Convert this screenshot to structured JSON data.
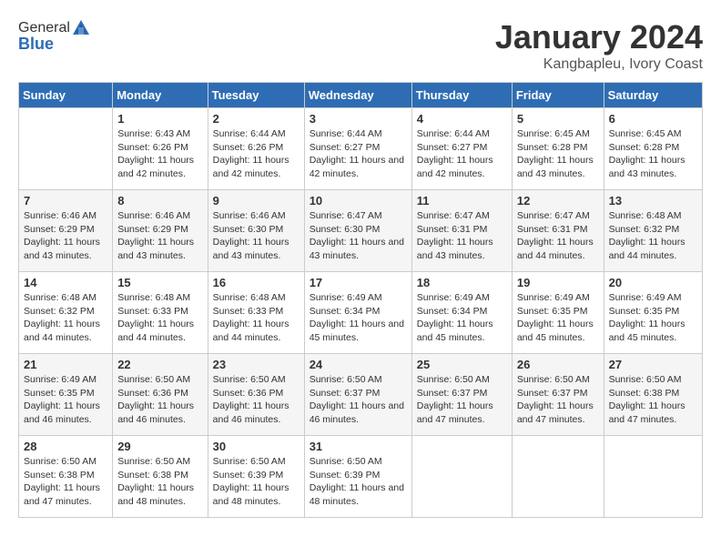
{
  "header": {
    "logo": {
      "general": "General",
      "blue": "Blue"
    },
    "title": "January 2024",
    "location": "Kangbapleu, Ivory Coast"
  },
  "weekdays": [
    "Sunday",
    "Monday",
    "Tuesday",
    "Wednesday",
    "Thursday",
    "Friday",
    "Saturday"
  ],
  "weeks": [
    [
      {
        "day": "",
        "sunrise": "",
        "sunset": "",
        "daylight": ""
      },
      {
        "day": "1",
        "sunrise": "Sunrise: 6:43 AM",
        "sunset": "Sunset: 6:26 PM",
        "daylight": "Daylight: 11 hours and 42 minutes."
      },
      {
        "day": "2",
        "sunrise": "Sunrise: 6:44 AM",
        "sunset": "Sunset: 6:26 PM",
        "daylight": "Daylight: 11 hours and 42 minutes."
      },
      {
        "day": "3",
        "sunrise": "Sunrise: 6:44 AM",
        "sunset": "Sunset: 6:27 PM",
        "daylight": "Daylight: 11 hours and 42 minutes."
      },
      {
        "day": "4",
        "sunrise": "Sunrise: 6:44 AM",
        "sunset": "Sunset: 6:27 PM",
        "daylight": "Daylight: 11 hours and 42 minutes."
      },
      {
        "day": "5",
        "sunrise": "Sunrise: 6:45 AM",
        "sunset": "Sunset: 6:28 PM",
        "daylight": "Daylight: 11 hours and 43 minutes."
      },
      {
        "day": "6",
        "sunrise": "Sunrise: 6:45 AM",
        "sunset": "Sunset: 6:28 PM",
        "daylight": "Daylight: 11 hours and 43 minutes."
      }
    ],
    [
      {
        "day": "7",
        "sunrise": "Sunrise: 6:46 AM",
        "sunset": "Sunset: 6:29 PM",
        "daylight": "Daylight: 11 hours and 43 minutes."
      },
      {
        "day": "8",
        "sunrise": "Sunrise: 6:46 AM",
        "sunset": "Sunset: 6:29 PM",
        "daylight": "Daylight: 11 hours and 43 minutes."
      },
      {
        "day": "9",
        "sunrise": "Sunrise: 6:46 AM",
        "sunset": "Sunset: 6:30 PM",
        "daylight": "Daylight: 11 hours and 43 minutes."
      },
      {
        "day": "10",
        "sunrise": "Sunrise: 6:47 AM",
        "sunset": "Sunset: 6:30 PM",
        "daylight": "Daylight: 11 hours and 43 minutes."
      },
      {
        "day": "11",
        "sunrise": "Sunrise: 6:47 AM",
        "sunset": "Sunset: 6:31 PM",
        "daylight": "Daylight: 11 hours and 43 minutes."
      },
      {
        "day": "12",
        "sunrise": "Sunrise: 6:47 AM",
        "sunset": "Sunset: 6:31 PM",
        "daylight": "Daylight: 11 hours and 44 minutes."
      },
      {
        "day": "13",
        "sunrise": "Sunrise: 6:48 AM",
        "sunset": "Sunset: 6:32 PM",
        "daylight": "Daylight: 11 hours and 44 minutes."
      }
    ],
    [
      {
        "day": "14",
        "sunrise": "Sunrise: 6:48 AM",
        "sunset": "Sunset: 6:32 PM",
        "daylight": "Daylight: 11 hours and 44 minutes."
      },
      {
        "day": "15",
        "sunrise": "Sunrise: 6:48 AM",
        "sunset": "Sunset: 6:33 PM",
        "daylight": "Daylight: 11 hours and 44 minutes."
      },
      {
        "day": "16",
        "sunrise": "Sunrise: 6:48 AM",
        "sunset": "Sunset: 6:33 PM",
        "daylight": "Daylight: 11 hours and 44 minutes."
      },
      {
        "day": "17",
        "sunrise": "Sunrise: 6:49 AM",
        "sunset": "Sunset: 6:34 PM",
        "daylight": "Daylight: 11 hours and 45 minutes."
      },
      {
        "day": "18",
        "sunrise": "Sunrise: 6:49 AM",
        "sunset": "Sunset: 6:34 PM",
        "daylight": "Daylight: 11 hours and 45 minutes."
      },
      {
        "day": "19",
        "sunrise": "Sunrise: 6:49 AM",
        "sunset": "Sunset: 6:35 PM",
        "daylight": "Daylight: 11 hours and 45 minutes."
      },
      {
        "day": "20",
        "sunrise": "Sunrise: 6:49 AM",
        "sunset": "Sunset: 6:35 PM",
        "daylight": "Daylight: 11 hours and 45 minutes."
      }
    ],
    [
      {
        "day": "21",
        "sunrise": "Sunrise: 6:49 AM",
        "sunset": "Sunset: 6:35 PM",
        "daylight": "Daylight: 11 hours and 46 minutes."
      },
      {
        "day": "22",
        "sunrise": "Sunrise: 6:50 AM",
        "sunset": "Sunset: 6:36 PM",
        "daylight": "Daylight: 11 hours and 46 minutes."
      },
      {
        "day": "23",
        "sunrise": "Sunrise: 6:50 AM",
        "sunset": "Sunset: 6:36 PM",
        "daylight": "Daylight: 11 hours and 46 minutes."
      },
      {
        "day": "24",
        "sunrise": "Sunrise: 6:50 AM",
        "sunset": "Sunset: 6:37 PM",
        "daylight": "Daylight: 11 hours and 46 minutes."
      },
      {
        "day": "25",
        "sunrise": "Sunrise: 6:50 AM",
        "sunset": "Sunset: 6:37 PM",
        "daylight": "Daylight: 11 hours and 47 minutes."
      },
      {
        "day": "26",
        "sunrise": "Sunrise: 6:50 AM",
        "sunset": "Sunset: 6:37 PM",
        "daylight": "Daylight: 11 hours and 47 minutes."
      },
      {
        "day": "27",
        "sunrise": "Sunrise: 6:50 AM",
        "sunset": "Sunset: 6:38 PM",
        "daylight": "Daylight: 11 hours and 47 minutes."
      }
    ],
    [
      {
        "day": "28",
        "sunrise": "Sunrise: 6:50 AM",
        "sunset": "Sunset: 6:38 PM",
        "daylight": "Daylight: 11 hours and 47 minutes."
      },
      {
        "day": "29",
        "sunrise": "Sunrise: 6:50 AM",
        "sunset": "Sunset: 6:38 PM",
        "daylight": "Daylight: 11 hours and 48 minutes."
      },
      {
        "day": "30",
        "sunrise": "Sunrise: 6:50 AM",
        "sunset": "Sunset: 6:39 PM",
        "daylight": "Daylight: 11 hours and 48 minutes."
      },
      {
        "day": "31",
        "sunrise": "Sunrise: 6:50 AM",
        "sunset": "Sunset: 6:39 PM",
        "daylight": "Daylight: 11 hours and 48 minutes."
      },
      {
        "day": "",
        "sunrise": "",
        "sunset": "",
        "daylight": ""
      },
      {
        "day": "",
        "sunrise": "",
        "sunset": "",
        "daylight": ""
      },
      {
        "day": "",
        "sunrise": "",
        "sunset": "",
        "daylight": ""
      }
    ]
  ]
}
